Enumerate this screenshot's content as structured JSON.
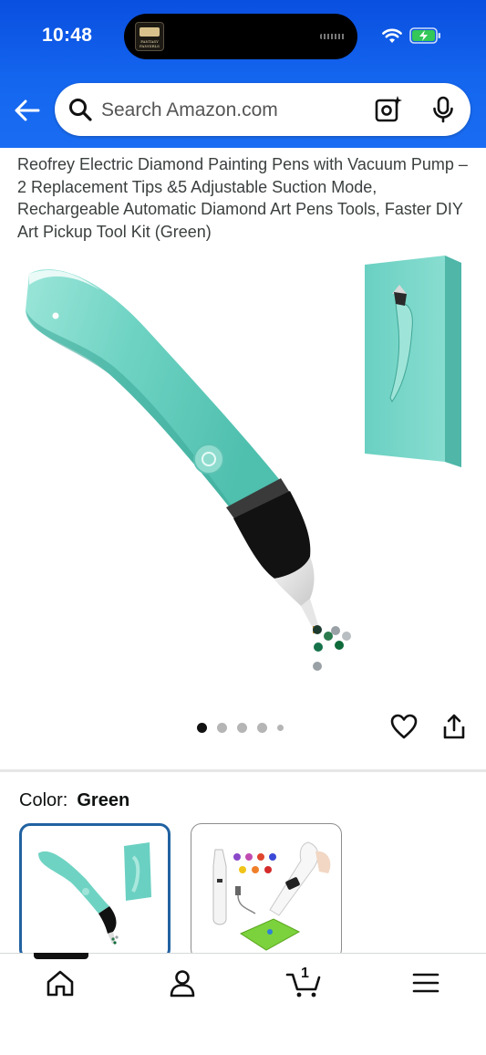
{
  "status_bar": {
    "time": "10:48",
    "island_thumb_text": "FANTASY FANGIRLS"
  },
  "search": {
    "placeholder": "Search Amazon.com"
  },
  "product": {
    "title": "Reofrey Electric Diamond Painting Pens with Vacuum Pump – 2 Replacement Tips &5 Adjustable Suction Mode, Rechargeable Automatic Diamond Art Pens Tools, Faster DIY Art Pickup Tool Kit (Green)"
  },
  "carousel": {
    "total": 5,
    "active": 1
  },
  "variation": {
    "label": "Color:",
    "value": "Green"
  },
  "cart": {
    "count": "1"
  },
  "colors": {
    "header_blue": "#1466ef",
    "pen_green": "#6fd3c3",
    "selected_border": "#2162a1"
  },
  "icons": [
    "back-arrow-icon",
    "search-icon",
    "camera-icon",
    "mic-icon",
    "heart-icon",
    "share-icon",
    "home-icon",
    "account-icon",
    "cart-icon",
    "menu-icon"
  ]
}
